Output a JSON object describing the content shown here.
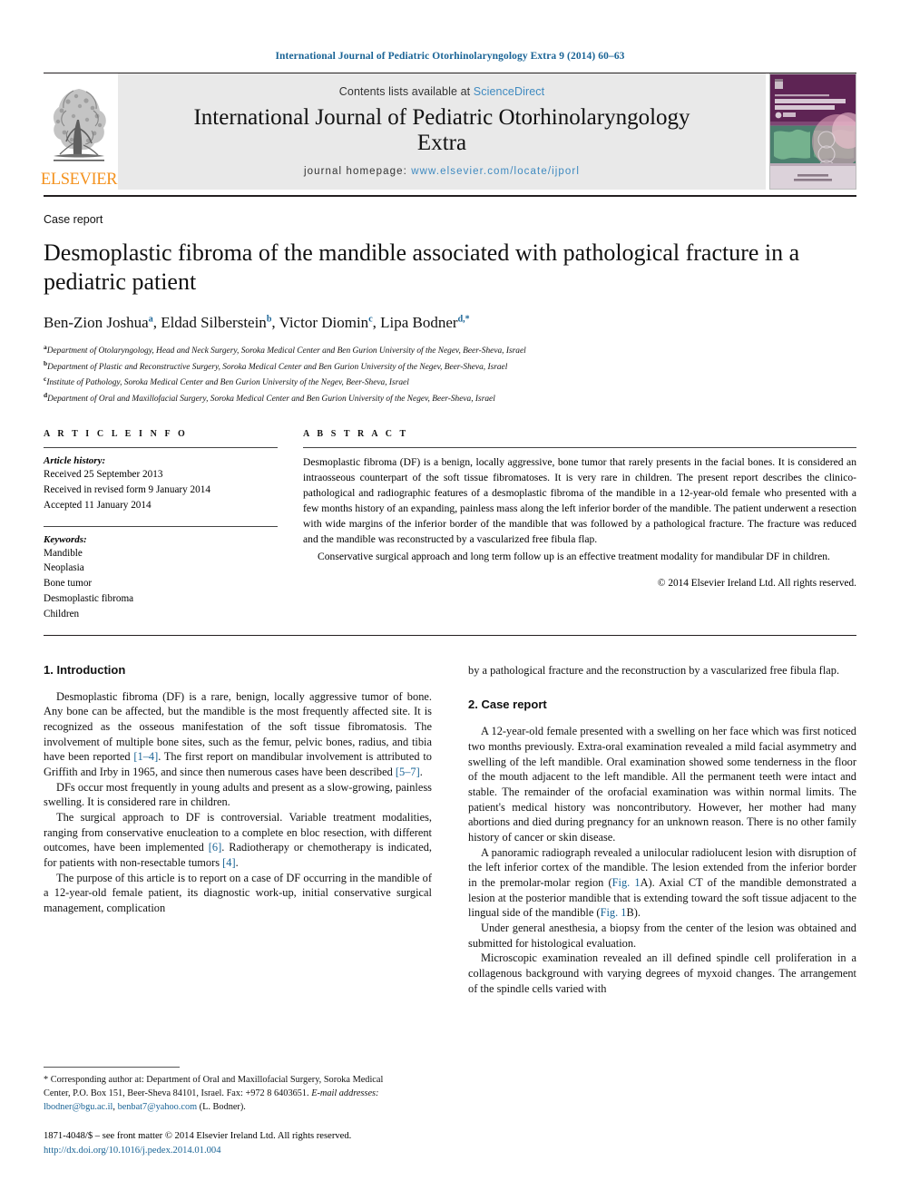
{
  "running_head": "International Journal of Pediatric Otorhinolaryngology Extra 9 (2014) 60–63",
  "masthead": {
    "publisher_name": "ELSEVIER",
    "contents_prefix": "Contents lists available at",
    "sciencedirect": "ScienceDirect",
    "journal_title_line1": "International Journal of Pediatric Otorhinolaryngology",
    "journal_title_line2": "Extra",
    "homepage_label": "journal homepage:",
    "homepage_url": "www.elsevier.com/locate/ijporl",
    "cover_alt": "journal-cover",
    "cover_title_small": "International Journal of",
    "cover_title_main": "Pediatric Otorhinolaryngology",
    "cover_title_extra": "Extra"
  },
  "colors": {
    "link": "#1a6496",
    "sciencedirect": "#3f8ac0",
    "elsevier_orange": "#f4921e",
    "cover_purple": "#6b2a5e",
    "masthead_gray": "#e9e9e9"
  },
  "article": {
    "doctype": "Case report",
    "title": "Desmoplastic fibroma of the mandible associated with pathological fracture in a pediatric patient",
    "authors": [
      {
        "name": "Ben-Zion Joshua",
        "sup": "a"
      },
      {
        "name": "Eldad Silberstein",
        "sup": "b"
      },
      {
        "name": "Victor Diomin",
        "sup": "c"
      },
      {
        "name": "Lipa Bodner",
        "sup": "d,*"
      }
    ],
    "affiliations": [
      {
        "mark": "a",
        "text": "Department of Otolaryngology, Head and Neck Surgery, Soroka Medical Center and Ben Gurion University of the Negev, Beer-Sheva, Israel"
      },
      {
        "mark": "b",
        "text": "Department of Plastic and Reconstructive Surgery, Soroka Medical Center and Ben Gurion University of the Negev, Beer-Sheva, Israel"
      },
      {
        "mark": "c",
        "text": "Institute of Pathology, Soroka Medical Center and Ben Gurion University of the Negev, Beer-Sheva, Israel"
      },
      {
        "mark": "d",
        "text": "Department of Oral and Maxillofacial Surgery, Soroka Medical Center and Ben Gurion University of the Negev, Beer-Sheva, Israel"
      }
    ]
  },
  "article_info": {
    "heading": "A R T I C L E   I N F O",
    "history_label": "Article history:",
    "history": [
      "Received 25 September 2013",
      "Received in revised form 9 January 2014",
      "Accepted 11 January 2014"
    ],
    "keywords_label": "Keywords:",
    "keywords": [
      "Mandible",
      "Neoplasia",
      "Bone tumor",
      "Desmoplastic fibroma",
      "Children"
    ]
  },
  "abstract": {
    "heading": "A B S T R A C T",
    "paragraph1": "Desmoplastic fibroma (DF) is a benign, locally aggressive, bone tumor that rarely presents in the facial bones. It is considered an intraosseous counterpart of the soft tissue fibromatoses. It is very rare in children. The present report describes the clinico-pathological and radiographic features of a desmoplastic fibroma of the mandible in a 12-year-old female who presented with a few months history of an expanding, painless mass along the left inferior border of the mandible. The patient underwent a resection with wide margins of the inferior border of the mandible that was followed by a pathological fracture. The fracture was reduced and the mandible was reconstructed by a vascularized free fibula flap.",
    "paragraph2": "Conservative surgical approach and long term follow up is an effective treatment modality for mandibular DF in children.",
    "copyright": "© 2014 Elsevier Ireland Ltd. All rights reserved."
  },
  "body": {
    "left_column": {
      "section1_heading": "1. Introduction",
      "p1_a": "Desmoplastic fibroma (DF) is a rare, benign, locally aggressive tumor of bone. Any bone can be affected, but the mandible is the most frequently affected site. It is recognized as the osseous manifestation of the soft tissue fibromatosis. The involvement of multiple bone sites, such as the femur, pelvic bones, radius, and tibia have been reported ",
      "p1_ref1": "[1–4]",
      "p1_b": ". The first report on mandibular involvement is attributed to Griffith and Irby in 1965, and since then numerous cases have been described ",
      "p1_ref2": "[5–7]",
      "p1_c": ".",
      "p2": "DFs occur most frequently in young adults and present as a slow-growing, painless swelling. It is considered rare in children.",
      "p3_a": "The surgical approach to DF is controversial. Variable treatment modalities, ranging from conservative enucleation to a complete en bloc resection, with different outcomes, have been implemented ",
      "p3_ref1": "[6]",
      "p3_b": ". Radiotherapy or chemotherapy is indicated, for patients with non-resectable tumors ",
      "p3_ref2": "[4]",
      "p3_c": ".",
      "p4": "The purpose of this article is to report on a case of DF occurring in the mandible of a 12-year-old female patient, its diagnostic work-up, initial conservative surgical management, complication"
    },
    "right_column": {
      "p_continue": "by a pathological fracture and the reconstruction by a vascularized free fibula flap.",
      "section2_heading": "2. Case report",
      "p1": "A 12-year-old female presented with a swelling on her face which was first noticed two months previously. Extra-oral examination revealed a mild facial asymmetry and swelling of the left mandible. Oral examination showed some tenderness in the floor of the mouth adjacent to the left mandible. All the permanent teeth were intact and stable. The remainder of the orofacial examination was within normal limits. The patient's medical history was noncontributory. However, her mother had many abortions and died during pregnancy for an unknown reason. There is no other family history of cancer or skin disease.",
      "p2_a": "A panoramic radiograph revealed a unilocular radiolucent lesion with disruption of the left inferior cortex of the mandible. The lesion extended from the inferior border in the premolar-molar region (",
      "p2_fig1": "Fig. 1",
      "p2_b": "A). Axial CT of the mandible demonstrated a lesion at the posterior mandible that is extending toward the soft tissue adjacent to the lingual side of the mandible (",
      "p2_fig2": "Fig. 1",
      "p2_c": "B).",
      "p3": "Under general anesthesia, a biopsy from the center of the lesion was obtained and submitted for histological evaluation.",
      "p4": "Microscopic examination revealed an ill defined spindle cell proliferation in a collagenous background with varying degrees of myxoid changes. The arrangement of the spindle cells varied with"
    }
  },
  "footnote": {
    "star": "*",
    "corresponding_a": " Corresponding author at: Department of Oral and Maxillofacial Surgery, Soroka Medical Center, P.O. Box 151, Beer-Sheva 84101, Israel. Fax: +972 8 6403651.",
    "email_label": "E-mail addresses:",
    "email1": "lbodner@bgu.ac.il",
    "email_sep": ", ",
    "email2": "benbat7@yahoo.com",
    "email_suffix": " (L. Bodner)."
  },
  "imprint": {
    "line1": "1871-4048/$ – see front matter © 2014 Elsevier Ireland Ltd. All rights reserved.",
    "doi": "http://dx.doi.org/10.1016/j.pedex.2014.01.004"
  }
}
